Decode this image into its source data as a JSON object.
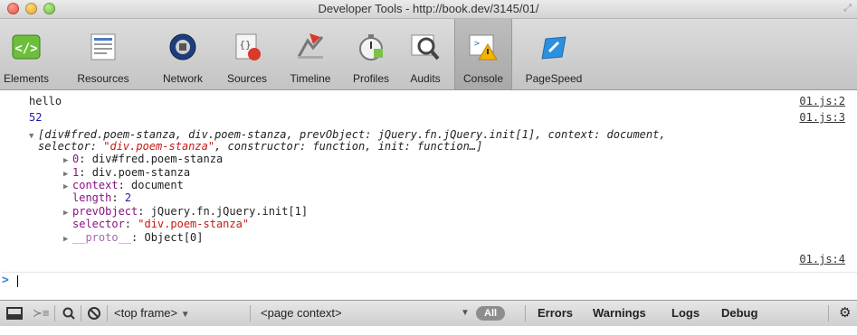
{
  "window": {
    "title": "Developer Tools - http://book.dev/3145/01/"
  },
  "toolbar": {
    "tabs": [
      {
        "label": "Elements",
        "icon": "elements-icon"
      },
      {
        "label": "Resources",
        "icon": "resources-icon"
      },
      {
        "label": "Network",
        "icon": "network-icon"
      },
      {
        "label": "Sources",
        "icon": "sources-icon"
      },
      {
        "label": "Timeline",
        "icon": "timeline-icon"
      },
      {
        "label": "Profiles",
        "icon": "profiles-icon"
      },
      {
        "label": "Audits",
        "icon": "audits-icon"
      },
      {
        "label": "Console",
        "icon": "console-icon",
        "active": true
      },
      {
        "label": "PageSpeed",
        "icon": "pagespeed-icon"
      }
    ]
  },
  "console": {
    "log1": {
      "text": "hello",
      "source": "01.js:2"
    },
    "log2": {
      "text": "52",
      "source": "01.js:3"
    },
    "object": {
      "summary_a": "[div#fred.poem-stanza, div.poem-stanza, prevObject: jQuery.fn.jQuery.init[1], context: document,",
      "summary_b_pre": "selector: ",
      "summary_b_str": "\"div.poem-stanza\"",
      "summary_b_post": ", constructor: function, init: function…]",
      "props": [
        {
          "key": "0",
          "value": "div#fred.poem-stanza"
        },
        {
          "key": "1",
          "value": "div.poem-stanza"
        },
        {
          "key": "context",
          "value": "document"
        },
        {
          "key": "length",
          "value": "2"
        },
        {
          "key": "prevObject",
          "value": "jQuery.fn.jQuery.init[1]"
        },
        {
          "key": "selector",
          "value": "\"div.poem-stanza\""
        },
        {
          "key": "__proto__",
          "value": "Object[0]"
        }
      ],
      "source": "01.js:4"
    },
    "prompt": ">"
  },
  "statusbar": {
    "frame_select": "<top frame>",
    "context_select": "<page context>",
    "filters": [
      "All",
      "Errors",
      "Warnings",
      "Logs",
      "Debug"
    ]
  }
}
